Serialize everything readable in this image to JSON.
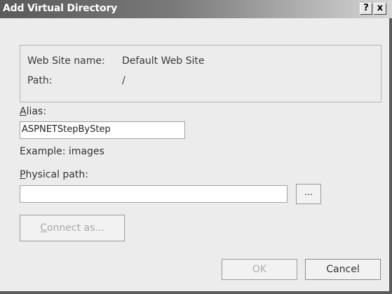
{
  "window": {
    "title": "Add Virtual Directory",
    "help_label": "?",
    "close_label": "x"
  },
  "info": {
    "site_label": "Web Site name:",
    "site_value": "Default Web Site",
    "path_label": "Path:",
    "path_value": "/"
  },
  "alias": {
    "label_accel": "A",
    "label_rest": "lias:",
    "value": "ASPNETStepByStep",
    "example": "Example: images"
  },
  "physical_path": {
    "label_accel": "P",
    "label_rest": "hysical path:",
    "value": "",
    "browse_label": "..."
  },
  "buttons": {
    "connect_accel": "C",
    "connect_rest": "onnect as...",
    "ok_label": "OK",
    "cancel_label": "Cancel"
  },
  "colors": {
    "dialog_bg": "#ececec",
    "titlebar_dark": "#5a5a5a",
    "titlebar_light": "#d6d6d6",
    "disabled_text": "#a8a8a8"
  }
}
